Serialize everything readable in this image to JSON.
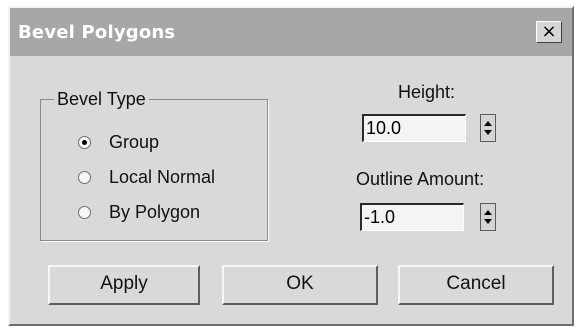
{
  "window": {
    "title": "Bevel Polygons",
    "close_label": "×"
  },
  "bevel_type": {
    "label": "Bevel Type",
    "options": [
      {
        "label": "Group",
        "checked": true
      },
      {
        "label": "Local Normal",
        "checked": false
      },
      {
        "label": "By Polygon",
        "checked": false
      }
    ]
  },
  "height": {
    "label": "Height:",
    "value": "10.0"
  },
  "outline": {
    "label": "Outline Amount:",
    "value": "-1.0"
  },
  "buttons": {
    "apply": "Apply",
    "ok": "OK",
    "cancel": "Cancel"
  },
  "colors": {
    "titlebar": "#a7a7a7",
    "dialog_bg": "#d9d9d9"
  }
}
